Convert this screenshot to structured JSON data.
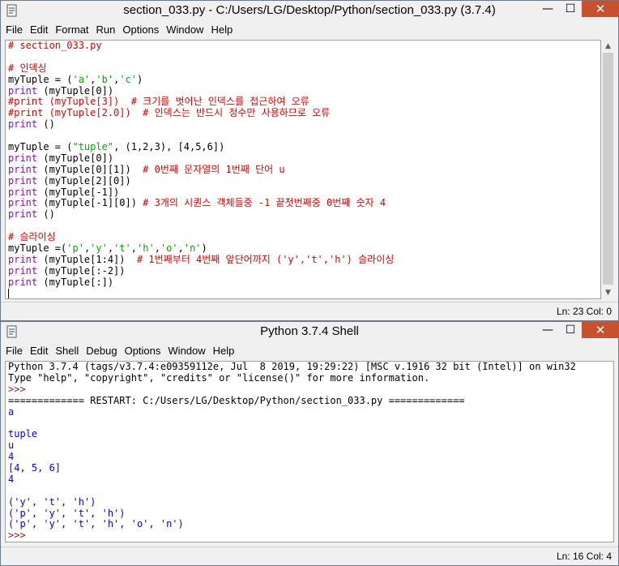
{
  "editor": {
    "title": "section_033.py - C:/Users/LG/Desktop/Python/section_033.py (3.7.4)",
    "menu": [
      "File",
      "Edit",
      "Format",
      "Run",
      "Options",
      "Window",
      "Help"
    ],
    "status": "Ln: 23  Col: 0",
    "code": [
      [
        {
          "t": "# section_033.py",
          "c": "cm"
        }
      ],
      [],
      [
        {
          "t": "# 인덱싱",
          "c": "cm"
        }
      ],
      [
        {
          "t": "myTuple = (",
          "c": "tx"
        },
        {
          "t": "'a'",
          "c": "st"
        },
        {
          "t": ",",
          "c": "tx"
        },
        {
          "t": "'b'",
          "c": "st"
        },
        {
          "t": ",",
          "c": "tx"
        },
        {
          "t": "'c'",
          "c": "st"
        },
        {
          "t": ")",
          "c": "tx"
        }
      ],
      [
        {
          "t": "print",
          "c": "kw"
        },
        {
          "t": " (myTuple[0])",
          "c": "tx"
        }
      ],
      [
        {
          "t": "#print (myTuple[3])  # 크기를 벗어난 인덱스를 접근하여 오류",
          "c": "cm"
        }
      ],
      [
        {
          "t": "#print (myTuple[2.0])  # 인덱스는 반드시 정수만 사용하므로 오류",
          "c": "cm"
        }
      ],
      [
        {
          "t": "print",
          "c": "kw"
        },
        {
          "t": " ()",
          "c": "tx"
        }
      ],
      [],
      [
        {
          "t": "myTuple = (",
          "c": "tx"
        },
        {
          "t": "\"tuple\"",
          "c": "st"
        },
        {
          "t": ", (1,2,3), [4,5,6])",
          "c": "tx"
        }
      ],
      [
        {
          "t": "print",
          "c": "kw"
        },
        {
          "t": " (myTuple[0])",
          "c": "tx"
        }
      ],
      [
        {
          "t": "print",
          "c": "kw"
        },
        {
          "t": " (myTuple[0][1])  ",
          "c": "tx"
        },
        {
          "t": "# 0번째 문자열의 1번째 단어 u",
          "c": "cm"
        }
      ],
      [
        {
          "t": "print",
          "c": "kw"
        },
        {
          "t": " (myTuple[2][0])",
          "c": "tx"
        }
      ],
      [
        {
          "t": "print",
          "c": "kw"
        },
        {
          "t": " (myTuple[-1])",
          "c": "tx"
        }
      ],
      [
        {
          "t": "print",
          "c": "kw"
        },
        {
          "t": " (myTuple[-1][0]) ",
          "c": "tx"
        },
        {
          "t": "# 3개의 시퀀스 객체들중 -1 끝첫번째중 0번째 숫자 4",
          "c": "cm"
        }
      ],
      [
        {
          "t": "print",
          "c": "kw"
        },
        {
          "t": " ()",
          "c": "tx"
        }
      ],
      [],
      [
        {
          "t": "# 슬라이싱",
          "c": "cm"
        }
      ],
      [
        {
          "t": "myTuple =(",
          "c": "tx"
        },
        {
          "t": "'p'",
          "c": "st"
        },
        {
          "t": ",",
          "c": "tx"
        },
        {
          "t": "'y'",
          "c": "st"
        },
        {
          "t": ",",
          "c": "tx"
        },
        {
          "t": "'t'",
          "c": "st"
        },
        {
          "t": ",",
          "c": "tx"
        },
        {
          "t": "'h'",
          "c": "st"
        },
        {
          "t": ",",
          "c": "tx"
        },
        {
          "t": "'o'",
          "c": "st"
        },
        {
          "t": ",",
          "c": "tx"
        },
        {
          "t": "'n'",
          "c": "st"
        },
        {
          "t": ")",
          "c": "tx"
        }
      ],
      [
        {
          "t": "print",
          "c": "kw"
        },
        {
          "t": " (myTuple[1:4])  ",
          "c": "tx"
        },
        {
          "t": "# 1번째부터 4번째 앞단어까지 ('y','t','h') 슬라이싱",
          "c": "cm"
        }
      ],
      [
        {
          "t": "print",
          "c": "kw"
        },
        {
          "t": " (myTuple[:-2])",
          "c": "tx"
        }
      ],
      [
        {
          "t": "print",
          "c": "kw"
        },
        {
          "t": " (myTuple[:])",
          "c": "tx"
        }
      ],
      []
    ]
  },
  "shell": {
    "title": "Python 3.7.4 Shell",
    "menu": [
      "File",
      "Edit",
      "Shell",
      "Debug",
      "Options",
      "Window",
      "Help"
    ],
    "status": "Ln: 16  Col: 4",
    "lines": [
      [
        {
          "t": "Python 3.7.4 (tags/v3.7.4:e09359112e, Jul  8 2019, 19:29:22) [MSC v.1916 32 bit (Intel)] on win32",
          "c": "tx"
        }
      ],
      [
        {
          "t": "Type \"help\", \"copyright\", \"credits\" or \"license()\" for more information.",
          "c": "tx"
        }
      ],
      [
        {
          "t": ">>> ",
          "c": "prompt"
        }
      ],
      [
        {
          "t": "============= RESTART: C:/Users/LG/Desktop/Python/section_033.py =============",
          "c": "tx"
        }
      ],
      [
        {
          "t": "a",
          "c": "out"
        }
      ],
      [],
      [
        {
          "t": "tuple",
          "c": "out"
        }
      ],
      [
        {
          "t": "u",
          "c": "out"
        }
      ],
      [
        {
          "t": "4",
          "c": "out"
        }
      ],
      [
        {
          "t": "[4, 5, 6]",
          "c": "out"
        }
      ],
      [
        {
          "t": "4",
          "c": "out"
        }
      ],
      [],
      [
        {
          "t": "('y', 't', 'h')",
          "c": "out"
        }
      ],
      [
        {
          "t": "('p', 'y', 't', 'h')",
          "c": "out"
        }
      ],
      [
        {
          "t": "('p', 'y', 't', 'h', 'o', 'n')",
          "c": "out"
        }
      ],
      [
        {
          "t": ">>> ",
          "c": "prompt"
        }
      ]
    ]
  },
  "window_controls": {
    "minimize": "—",
    "maximize": "☐",
    "close": "✕"
  }
}
